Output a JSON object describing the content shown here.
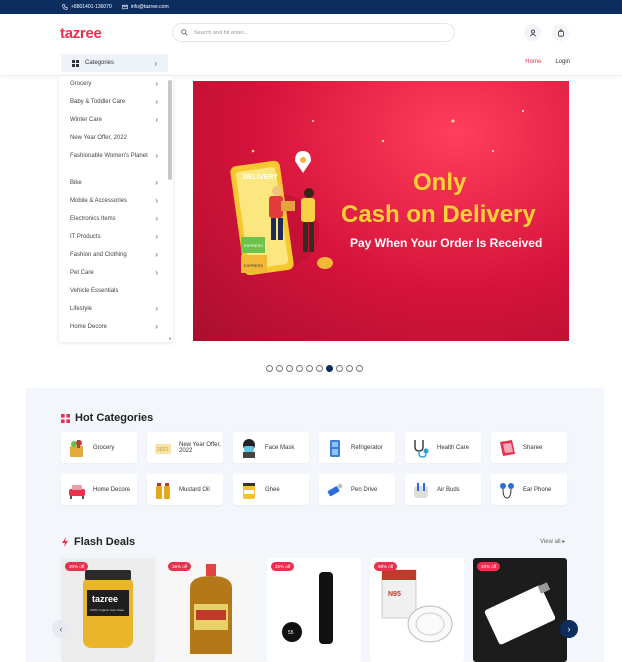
{
  "topbar": {
    "phone": "+8801401-136070",
    "email": "info@tazree.com"
  },
  "header": {
    "logo": "tazree",
    "search_placeholder": "Search and hit enter..."
  },
  "nav": {
    "categories_label": "Categories",
    "links": [
      "Home",
      "Login"
    ]
  },
  "sidebar": {
    "items": [
      {
        "label": "Grocery",
        "chevron": true
      },
      {
        "label": "Baby & Toddler Care",
        "chevron": true
      },
      {
        "label": "Winter Care",
        "chevron": true
      },
      {
        "label": "New Year Offer, 2022",
        "chevron": false
      },
      {
        "label": "Fashionable Women's Planet",
        "chevron": true
      },
      {
        "label": "Bike",
        "chevron": true
      },
      {
        "label": "Mobile & Accessories",
        "chevron": true
      },
      {
        "label": "Electronics Items",
        "chevron": true
      },
      {
        "label": "IT Products",
        "chevron": true
      },
      {
        "label": "Fashion and Clothing",
        "chevron": true
      },
      {
        "label": "Pet Care",
        "chevron": true
      },
      {
        "label": "Vehicle Essentials",
        "chevron": false
      },
      {
        "label": "Lifestyle",
        "chevron": true
      },
      {
        "label": "Home Decore",
        "chevron": true
      }
    ]
  },
  "banner": {
    "line1": "Only",
    "line2": "Cash on Delivery",
    "line3": "Pay When Your Order Is Received",
    "illustration_text": "DELIVERY",
    "box_label": "EXPRESS"
  },
  "slider": {
    "count": 10,
    "active_index": 6
  },
  "hot_categories": {
    "title": "Hot Categories",
    "items": [
      {
        "label": "Grocery",
        "icon": "grocery-icon"
      },
      {
        "label": "New Year Offer, 2022",
        "icon": "offer-icon"
      },
      {
        "label": "Face Mask",
        "icon": "face-mask-icon"
      },
      {
        "label": "Refrigerator",
        "icon": "refrigerator-icon"
      },
      {
        "label": "Health Care",
        "icon": "stethoscope-icon"
      },
      {
        "label": "Sharee",
        "icon": "sharee-icon"
      },
      {
        "label": "Home Decore",
        "icon": "sofa-icon"
      },
      {
        "label": "Mustard Oil",
        "icon": "oil-bottle-icon"
      },
      {
        "label": "Ghee",
        "icon": "ghee-jar-icon"
      },
      {
        "label": "Pen Drive",
        "icon": "pen-drive-icon"
      },
      {
        "label": "Air Buds",
        "icon": "air-buds-icon"
      },
      {
        "label": "Ear Phone",
        "icon": "earphone-icon"
      }
    ]
  },
  "flash_deals": {
    "title": "Flash Deals",
    "view_all": "View all",
    "products": [
      {
        "badge": "20% off",
        "image": "ghee-jar-product",
        "jar_label": "tazree",
        "jar_sublabel": "100% Organic Cow Ghee"
      },
      {
        "badge": "36% off",
        "image": "mustard-oil-bottle"
      },
      {
        "badge": "25% off",
        "image": "smart-thermos-bottle",
        "thermos_readout": "55"
      },
      {
        "badge": "58% off",
        "image": "n95-face-mask-box",
        "mask_box_text": "N95"
      },
      {
        "badge": "40% off",
        "image": "card-pen-drive"
      }
    ]
  },
  "colors": {
    "brand": "#e8304f",
    "navy": "#0b2e5e",
    "banner_yellow": "#ffd234"
  }
}
